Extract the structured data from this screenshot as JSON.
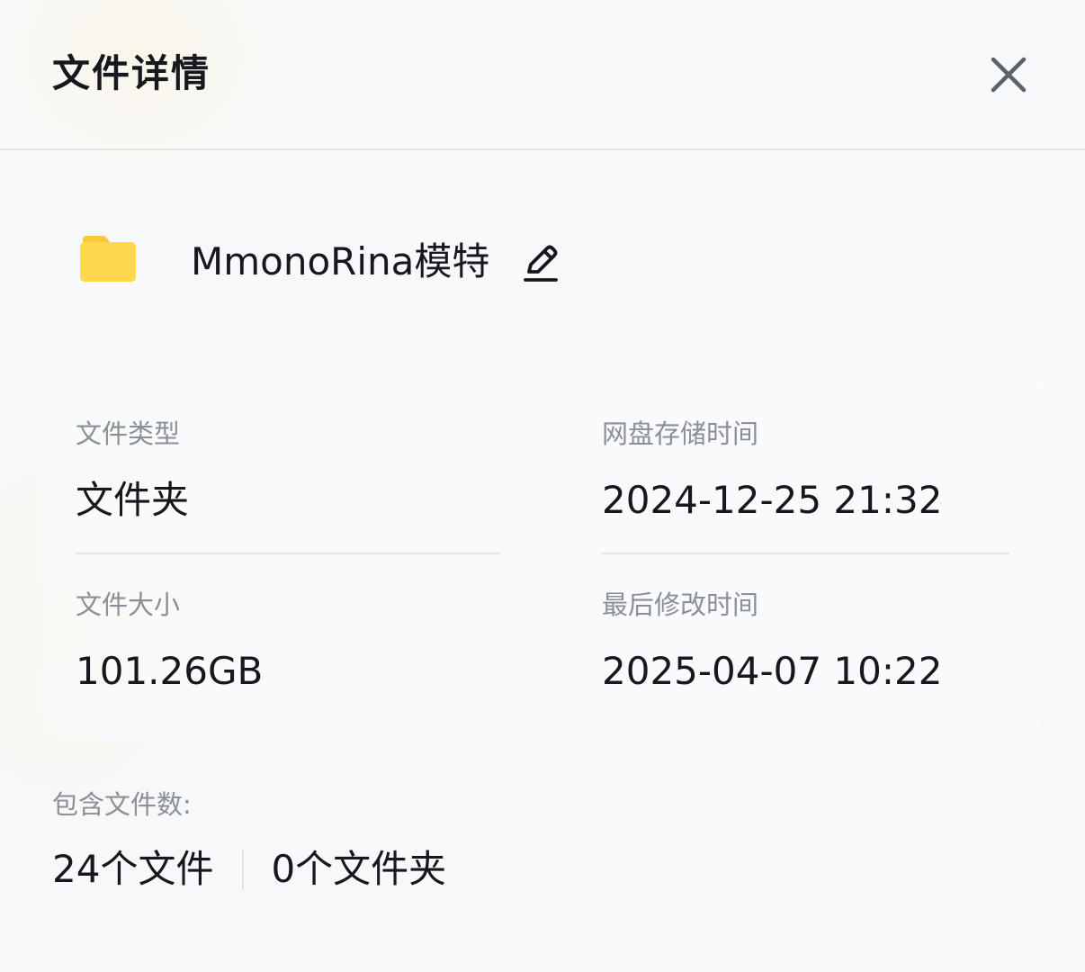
{
  "header": {
    "title": "文件详情"
  },
  "file": {
    "name": "MmonoRina模特",
    "icon": "folder-icon",
    "icon_color": "#FFD54F"
  },
  "details": {
    "type_label": "文件类型",
    "type_value": "文件夹",
    "stored_label": "网盘存储时间",
    "stored_value": "2024-12-25 21:32",
    "size_label": "文件大小",
    "size_value": "101.26GB",
    "modified_label": "最后修改时间",
    "modified_value": "2025-04-07 10:22"
  },
  "contents": {
    "label": "包含文件数:",
    "files": "24个文件",
    "folders": "0个文件夹"
  }
}
